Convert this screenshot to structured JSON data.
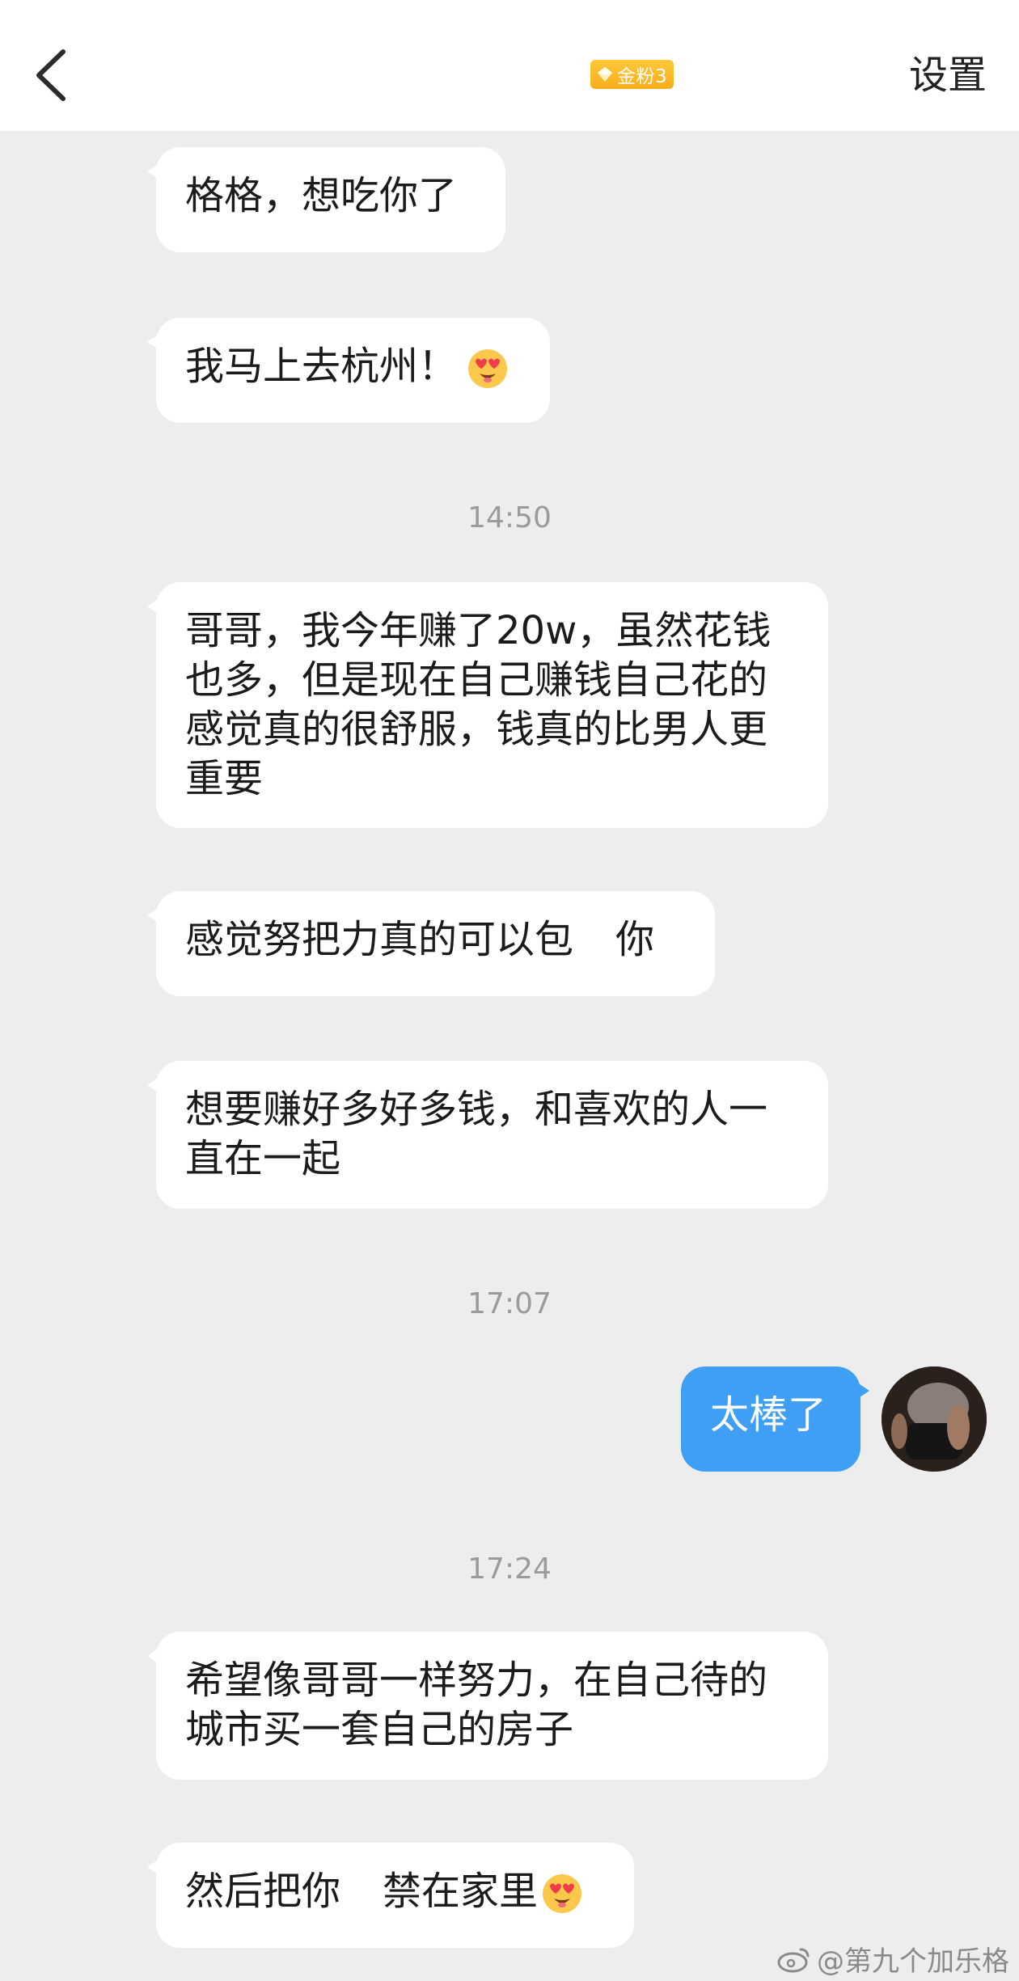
{
  "header": {
    "back_icon": "chevron-left-icon",
    "badge_label": "金粉3",
    "settings_label": "设置"
  },
  "messages": [
    {
      "side": "incoming",
      "text": "格格，想吃你了"
    },
    {
      "side": "incoming",
      "text": "我马上去杭州！",
      "emoji": "heart-eyes-emoji"
    },
    {
      "side": "timestamp",
      "text": "14:50"
    },
    {
      "side": "incoming",
      "text": "哥哥，我今年赚了20w，虽然花钱也多，但是现在自己赚钱自己花的感觉真的很舒服，钱真的比男人更重要"
    },
    {
      "side": "incoming",
      "text_a": "感觉努把力真的可以包",
      "text_b": "你"
    },
    {
      "side": "incoming",
      "text": "想要赚好多好多钱，和喜欢的人一直在一起"
    },
    {
      "side": "timestamp",
      "text": "17:07"
    },
    {
      "side": "outgoing",
      "text": "太棒了"
    },
    {
      "side": "timestamp",
      "text": "17:24"
    },
    {
      "side": "incoming",
      "text": "希望像哥哥一样努力，在自己待的城市买一套自己的房子"
    },
    {
      "side": "incoming",
      "text_a": "然后把你",
      "text_b": "禁在家里",
      "emoji": "heart-eyes-emoji"
    }
  ],
  "watermark": "@第九个加乐格",
  "colors": {
    "background": "#ededed",
    "incoming_bubble": "#ffffff",
    "outgoing_bubble": "#3e9ff5",
    "badge": "#f8ad1a"
  }
}
